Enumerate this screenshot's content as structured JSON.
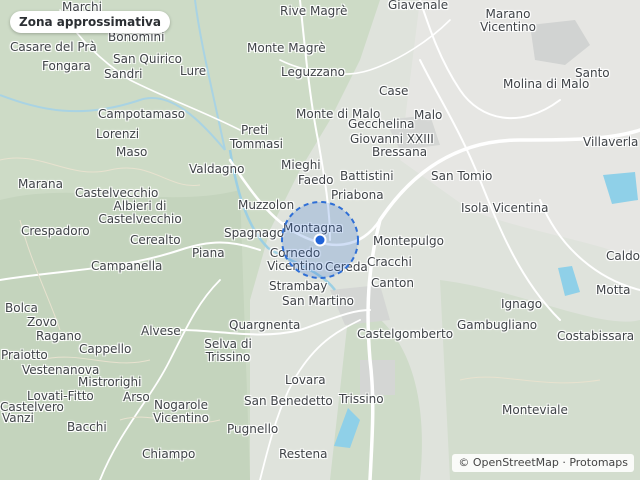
{
  "badge": {
    "label": "Zona approssimativa"
  },
  "attribution": {
    "text": "© OpenStreetMap · Protomaps"
  },
  "colors": {
    "land": "#dfe3dc",
    "terrain": "#c9d7c2",
    "water": "#8fd0e8",
    "road": "#ffffff",
    "urban": "#d2d2d2",
    "area_fill": "#2f6fd6",
    "marker": "#1f62d8"
  },
  "places": [
    "Marchi",
    "Rive Magrè",
    "Giavenale",
    "Marano Vicentino",
    "Zona approssimativa",
    "Bonomini",
    "Casare del Prà",
    "Monte Magrè",
    "Fongara",
    "San Quirico",
    "Sandri",
    "Lure",
    "Leguzzano",
    "Santo",
    "Molina di Malo",
    "Case",
    "Campotamaso",
    "Monte di Malo",
    "Malo",
    "Gecchelina",
    "Preti",
    "Tommasi",
    "Giovanni XXIII",
    "Lorenzi",
    "Bressana",
    "Villaverla",
    "Maso",
    "Mieghi",
    "Battistini",
    "Valdagno",
    "Faedo",
    "San Tomio",
    "Marana",
    "Castelvecchio",
    "Priabona",
    "Albieri di Castelvecchio",
    "Muzzolon",
    "Isola Vicentina",
    "Crespadoro",
    "Spagnago",
    "Montagna",
    "Cerealto",
    "Montepulgo",
    "Caldogno",
    "Cornedo Vicentino",
    "Piana",
    "Cereda",
    "Cracchi",
    "Campanella",
    "Canton",
    "Motta",
    "Strambay",
    "San Martino",
    "Ignago",
    "Bolca",
    "Zovo",
    "Quargnenta",
    "Gambugliano",
    "Castelgomberto",
    "Costabissara",
    "Ragano",
    "Alvese",
    "Selva di Trissino",
    "Cappello",
    "Praiotto",
    "Vestenanova",
    "Mistrorighi",
    "Lovara",
    "Arso",
    "Lovati-Fitto",
    "Nogarole Vicentino",
    "San Benedetto",
    "Trissino",
    "Monteviale",
    "Castelvero",
    "Vanzi",
    "Bacchi",
    "Pugnello",
    "Chiampo",
    "Restena"
  ],
  "marker": {
    "label": "approximate location"
  }
}
